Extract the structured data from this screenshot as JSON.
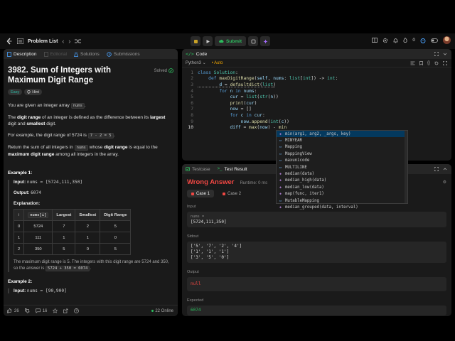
{
  "topbar": {
    "title": "Problem List",
    "submit_label": "Submit",
    "badge_count": "0"
  },
  "left": {
    "tabs": [
      {
        "label": "Description"
      },
      {
        "label": "Editorial"
      },
      {
        "label": "Solutions"
      },
      {
        "label": "Submissions"
      }
    ],
    "title": "3982. Sum of Integers with Maximum Digit Range",
    "solved_label": "Solved",
    "difficulty": "Easy",
    "hint_label": "Hint",
    "intro_pre": "You are given an integer array ",
    "intro_code": "nums",
    "intro_post": ".",
    "def_pre": "The ",
    "def_bold": "digit range",
    "def_mid": " of an integer is defined as the difference between its ",
    "def_bold2": "largest",
    "def_mid2": " digit and ",
    "def_bold3": "smallest",
    "def_post": " digit.",
    "example_pre": "For example, the digit range of 5724 is ",
    "example_code": "7 - 2 = 5",
    "example_post": ".",
    "ret_pre": "Return the sum of all integers in ",
    "ret_code": "nums",
    "ret_mid": " whose ",
    "ret_bold": "digit range",
    "ret_mid2": " is equal to the ",
    "ret_bold2": "maximum digit range",
    "ret_post": " among all integers in the array.",
    "ex1_title": "Example 1:",
    "ex1_input_label": "Input:",
    "ex1_input": "nums = [5724,111,350]",
    "ex1_output_label": "Output:",
    "ex1_output": "6074",
    "ex1_expl_label": "Explanation:",
    "table_headers": [
      "i",
      "nums[i]",
      "Largest",
      "Smallest",
      "Digit Range"
    ],
    "table_rows": [
      [
        "0",
        "5724",
        "7",
        "2",
        "5"
      ],
      [
        "1",
        "111",
        "1",
        "1",
        "0"
      ],
      [
        "2",
        "350",
        "5",
        "0",
        "5"
      ]
    ],
    "ex1_note_pre": "The maximum digit range is 5. The integers with this digit range are 5724 and 350, so the answer is ",
    "ex1_note_code": "5724 + 350 = 6074",
    "ex1_note_post": ".",
    "ex2_title": "Example 2:",
    "ex2_input_label": "Input:",
    "ex2_input": "nums = [90,900]",
    "likes": "26",
    "comments": "16",
    "online": "22 Online"
  },
  "code": {
    "tab_label": "Code",
    "language": "Python3",
    "autosave": "Auto",
    "lines": [
      {
        "n": "1",
        "t": "class Solution:"
      },
      {
        "n": "2",
        "t": "    def maxDigitRange(self, nums: list[int]) -> int:"
      },
      {
        "n": "3",
        "t": "        d = defaultdict(list)"
      },
      {
        "n": "4",
        "t": "        for n in nums:"
      },
      {
        "n": "5",
        "t": "            cur = list(str(n))"
      },
      {
        "n": "6",
        "t": "            print(cur)"
      },
      {
        "n": "7",
        "t": "            now = []"
      },
      {
        "n": "8",
        "t": "            for c in cur:"
      },
      {
        "n": "9",
        "t": "                now.append(int(c))"
      },
      {
        "n": "10",
        "t": "            diff = max(now) - min"
      }
    ]
  },
  "autocomplete": {
    "items": [
      {
        "label": "min(arg1, arg2, _args, key)",
        "kind": "fn"
      },
      {
        "label": "MINYEAR",
        "kind": "var"
      },
      {
        "label": "Mapping",
        "kind": "var"
      },
      {
        "label": "MappingView",
        "kind": "var"
      },
      {
        "label": "maxunicode",
        "kind": "var"
      },
      {
        "label": "MULTILINE",
        "kind": "var"
      },
      {
        "label": "median(data)",
        "kind": "fn"
      },
      {
        "label": "median_high(data)",
        "kind": "fn"
      },
      {
        "label": "median_low(data)",
        "kind": "fn"
      },
      {
        "label": "map(func, iter1)",
        "kind": "fn"
      },
      {
        "label": "MutableMapping",
        "kind": "var"
      },
      {
        "label": "median_grouped(data, interval)",
        "kind": "fn"
      }
    ]
  },
  "result": {
    "tabs": [
      {
        "label": "Testcase"
      },
      {
        "label": "Test Result"
      }
    ],
    "verdict": "Wrong Answer",
    "runtime": "Runtime: 0 ms",
    "cases": [
      {
        "label": "Case 1"
      },
      {
        "label": "Case 2"
      }
    ],
    "input_label": "Input",
    "input_var": "nums =",
    "input_value": "[5724,111,350]",
    "stdout_label": "Stdout",
    "stdout_lines": [
      "['5', '7', '2', '4']",
      "['1', '1', '1']",
      "['3', '5', '0']"
    ],
    "output_label": "Output",
    "output_value": "null",
    "expected_label": "Expected",
    "expected_value": "6074"
  },
  "colors": {
    "accent_green": "#2cbb5d",
    "error_red": "#ef4743",
    "easy_teal": "#2cbba6",
    "auto_orange": "#f0a500"
  }
}
